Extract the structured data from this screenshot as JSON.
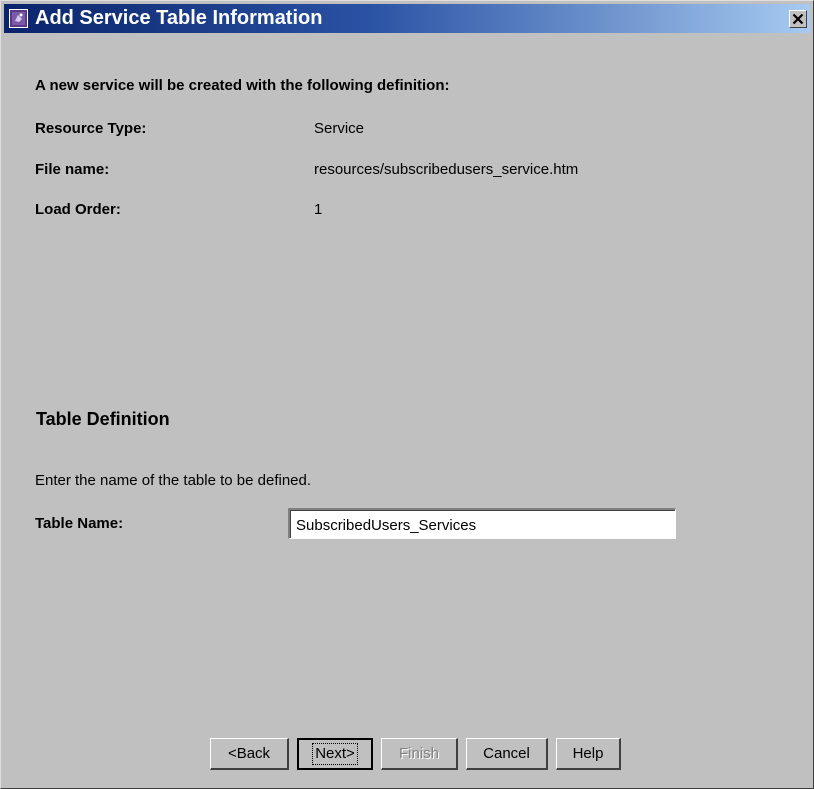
{
  "window": {
    "title": "Add Service Table Information",
    "close_icon": "close-icon",
    "app_icon": "app-icon"
  },
  "intro": "A new service will be created with the following definition:",
  "definition": {
    "resource_type_label": "Resource Type:",
    "resource_type_value": "Service",
    "file_name_label": "File name:",
    "file_name_value": "resources/subscribedusers_service.htm",
    "load_order_label": "Load Order:",
    "load_order_value": "1"
  },
  "table_definition": {
    "heading": "Table Definition",
    "instruction": "Enter the name of the table to be defined.",
    "table_name_label": "Table Name:",
    "table_name_value": "SubscribedUsers_Services"
  },
  "buttons": {
    "back": "<Back",
    "next": "Next>",
    "finish": "Finish",
    "cancel": "Cancel",
    "help": "Help"
  },
  "colors": {
    "dialog_background": "#c0c0c0",
    "titlebar_start": "#0a246a",
    "titlebar_end": "#a6caf0"
  }
}
